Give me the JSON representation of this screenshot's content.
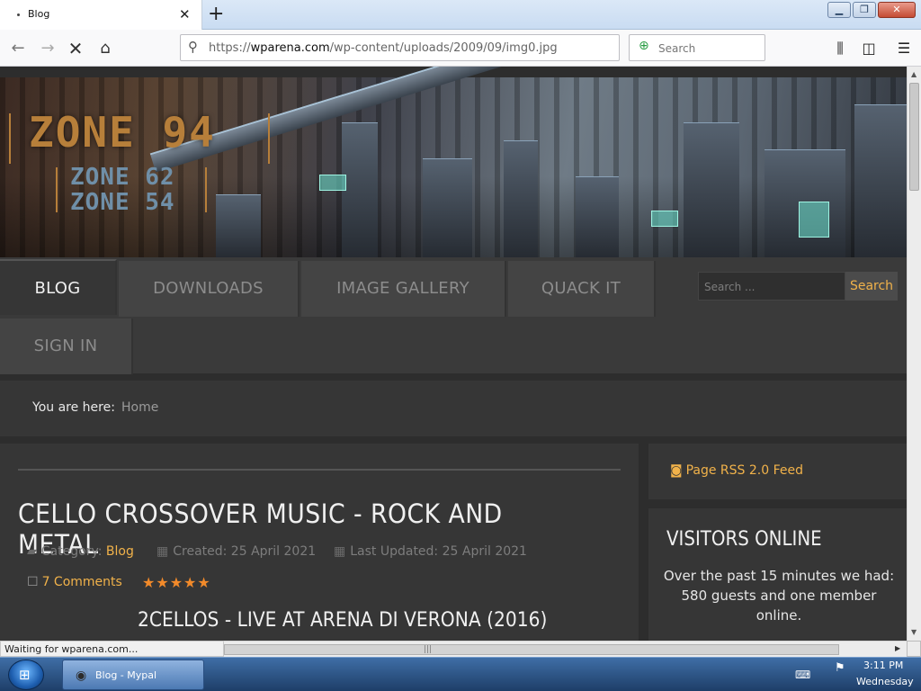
{
  "browser": {
    "tab_title": "Blog",
    "tab_close": "✕",
    "new_tab": "+",
    "url_prefix": "https://",
    "url_host": "wparena.com",
    "url_path": "/wp-content/uploads/2009/09/img0.jpg",
    "search_placeholder": "Search",
    "status_text": "Waiting for wparena.com..."
  },
  "site": {
    "logo_primary": "ZONE 94",
    "logo_secondary_1": "ZONE 62",
    "logo_secondary_2": "ZONE 54",
    "menu": [
      {
        "label": "BLOG",
        "active": true
      },
      {
        "label": "DOWNLOADS",
        "active": false
      },
      {
        "label": "IMAGE GALLERY",
        "active": false
      },
      {
        "label": "QUACK IT",
        "active": false
      },
      {
        "label": "SIGN IN",
        "active": false
      }
    ],
    "search_placeholder": "Search ...",
    "search_button": "Search",
    "breadcrumb_label": "You are here:",
    "breadcrumb_value": "Home"
  },
  "article": {
    "title": "CELLO CROSSOVER MUSIC - ROCK AND METAL",
    "category_label": "Category:",
    "category_value": "Blog",
    "created": "Created: 25 April 2021",
    "updated": "Last Updated: 25 April 2021",
    "comments": "7 Comments",
    "rating": 5,
    "stars": "★★★★★",
    "subtitle": "2CELLOS - LIVE AT ARENA DI VERONA (2016)"
  },
  "sidebar": {
    "rss": "Page RSS 2.0 Feed",
    "visitors_title": "VISITORS ONLINE",
    "visitors_text": "Over the past 15 minutes we had: 580 guests and one member online."
  },
  "taskbar": {
    "task_label": "Blog - Mypal",
    "time": "3:11 PM",
    "day": "Wednesday"
  },
  "colors": {
    "accent": "#f1b24a",
    "star": "#f28a2a",
    "page_bg": "#2d2d2d",
    "panel_bg": "#363636"
  }
}
